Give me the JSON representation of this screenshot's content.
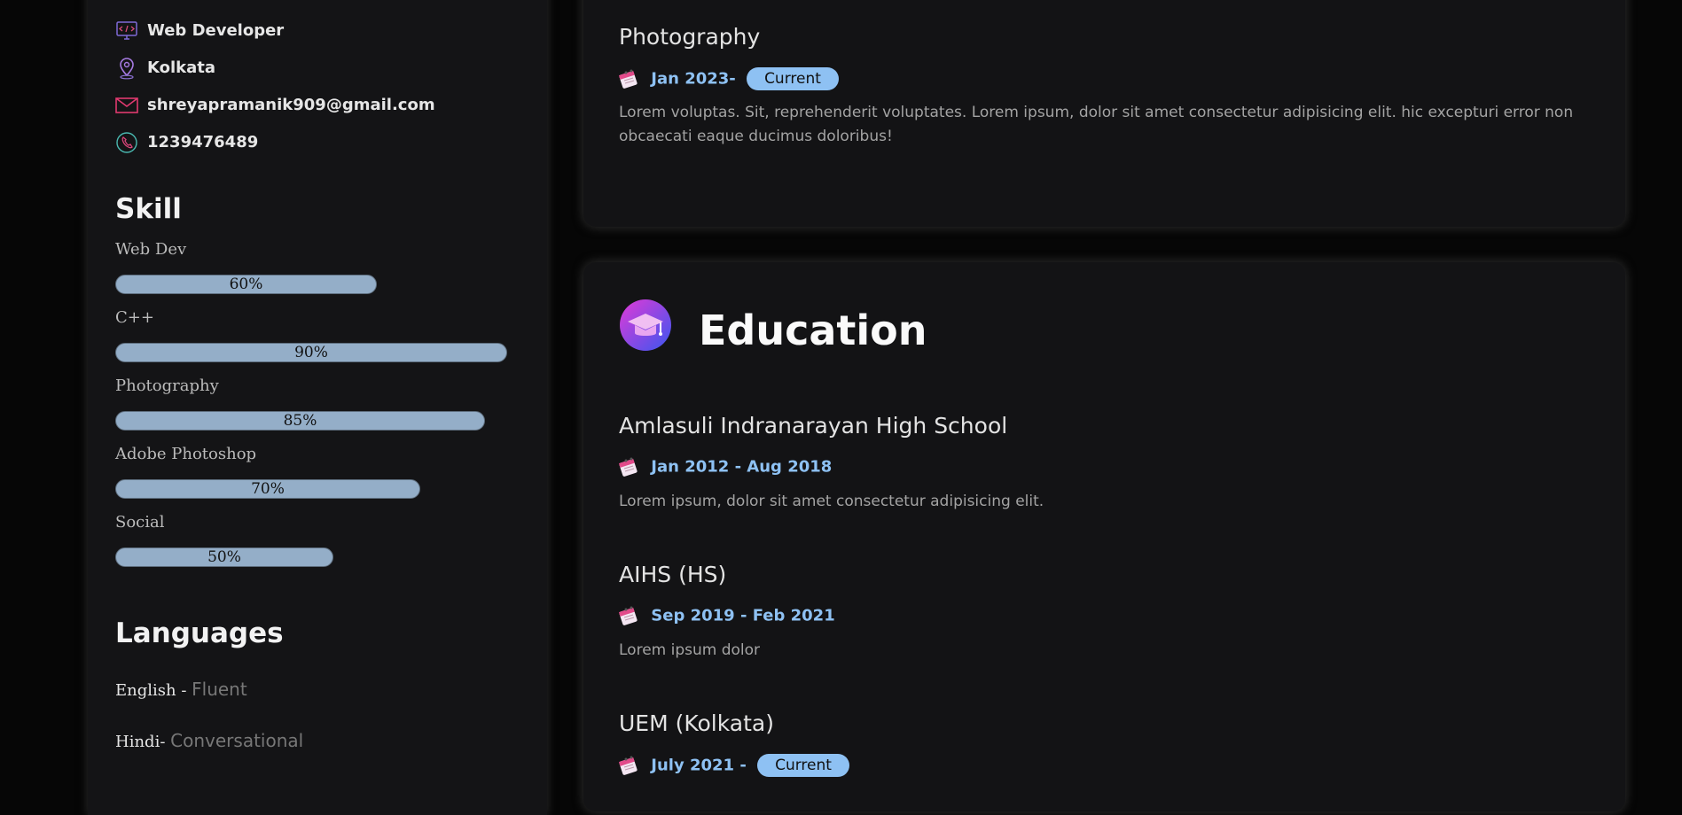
{
  "sidebar": {
    "contact": {
      "role": "Web Developer",
      "location": "Kolkata",
      "email": "shreyapramanik909@gmail.com",
      "phone": "1239476489"
    },
    "skill_heading": "Skill",
    "skills": [
      {
        "name": "Web Dev",
        "label": "60%",
        "level": 60
      },
      {
        "name": "C++",
        "label": "90%",
        "level": 90
      },
      {
        "name": "Photography",
        "label": "85%",
        "level": 85
      },
      {
        "name": "Adobe Photoshop",
        "label": "70%",
        "level": 70
      },
      {
        "name": "Social",
        "label": "50%",
        "level": 50
      }
    ],
    "languages_heading": "Languages",
    "languages": [
      {
        "name": "English -",
        "level": "Fluent"
      },
      {
        "name": "Hindi-",
        "level": "Conversational"
      }
    ]
  },
  "experience": {
    "title": "Photography",
    "date": "Jan 2023-",
    "badge": "Current",
    "description": "Lorem voluptas. Sit, reprehenderit voluptates. Lorem ipsum, dolor sit amet consectetur adipisicing elit. hic excepturi error non obcaecati eaque ducimus doloribus!"
  },
  "education": {
    "heading": "Education",
    "items": [
      {
        "title": "Amlasuli Indranarayan High School",
        "date": "Jan 2012 - Aug 2018",
        "description": "Lorem ipsum, dolor sit amet consectetur adipisicing elit."
      },
      {
        "title": "AIHS (HS)",
        "date": "Sep 2019 - Feb 2021",
        "description": "Lorem ipsum dolor"
      },
      {
        "title": "UEM (Kolkata)",
        "date": "July 2021 -",
        "badge": "Current"
      }
    ]
  },
  "colors": {
    "accent": "#8ec1f3",
    "bar_fill": "#94aec8",
    "card_bg": "#131315",
    "page_bg": "#060606"
  },
  "icons": [
    "monitor-code-icon",
    "location-pin-icon",
    "mail-icon",
    "phone-icon",
    "calendar-icon",
    "graduation-cap-icon"
  ]
}
